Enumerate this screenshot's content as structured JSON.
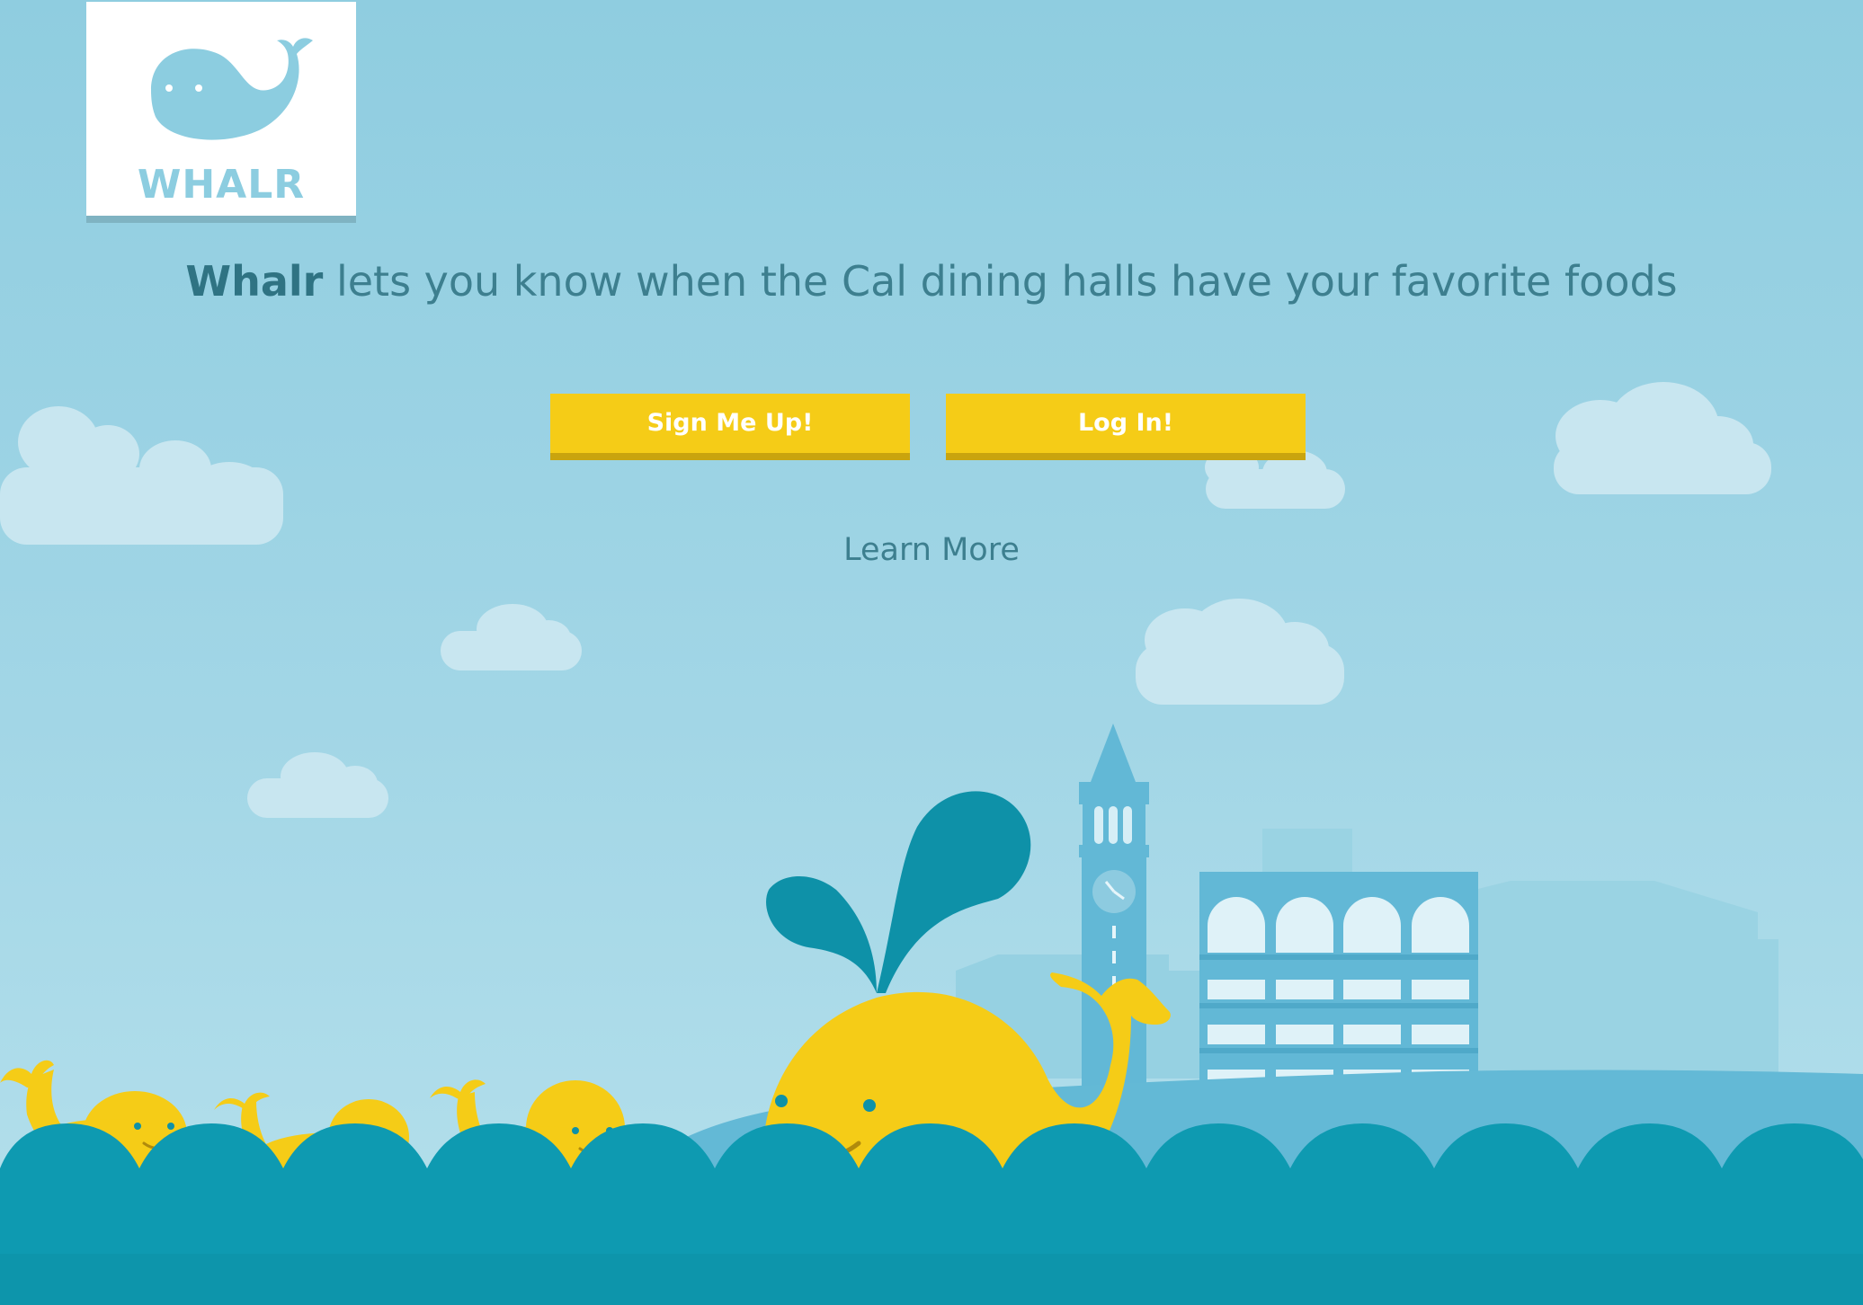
{
  "logo": {
    "text": "WHALR",
    "icon": "whale-icon"
  },
  "tagline": {
    "brand": "Whalr",
    "rest": " lets you know when the Cal dining halls have your favorite foods"
  },
  "buttons": {
    "signup": "Sign Me Up!",
    "login": "Log In!"
  },
  "links": {
    "learn_more": "Learn More"
  },
  "colors": {
    "sky": "#8fcde0",
    "water": "#0e9ab1",
    "button": "#f5cc17",
    "whale": "#f5cc17",
    "text": "#3d7f8f",
    "building": "#63b9d6"
  }
}
